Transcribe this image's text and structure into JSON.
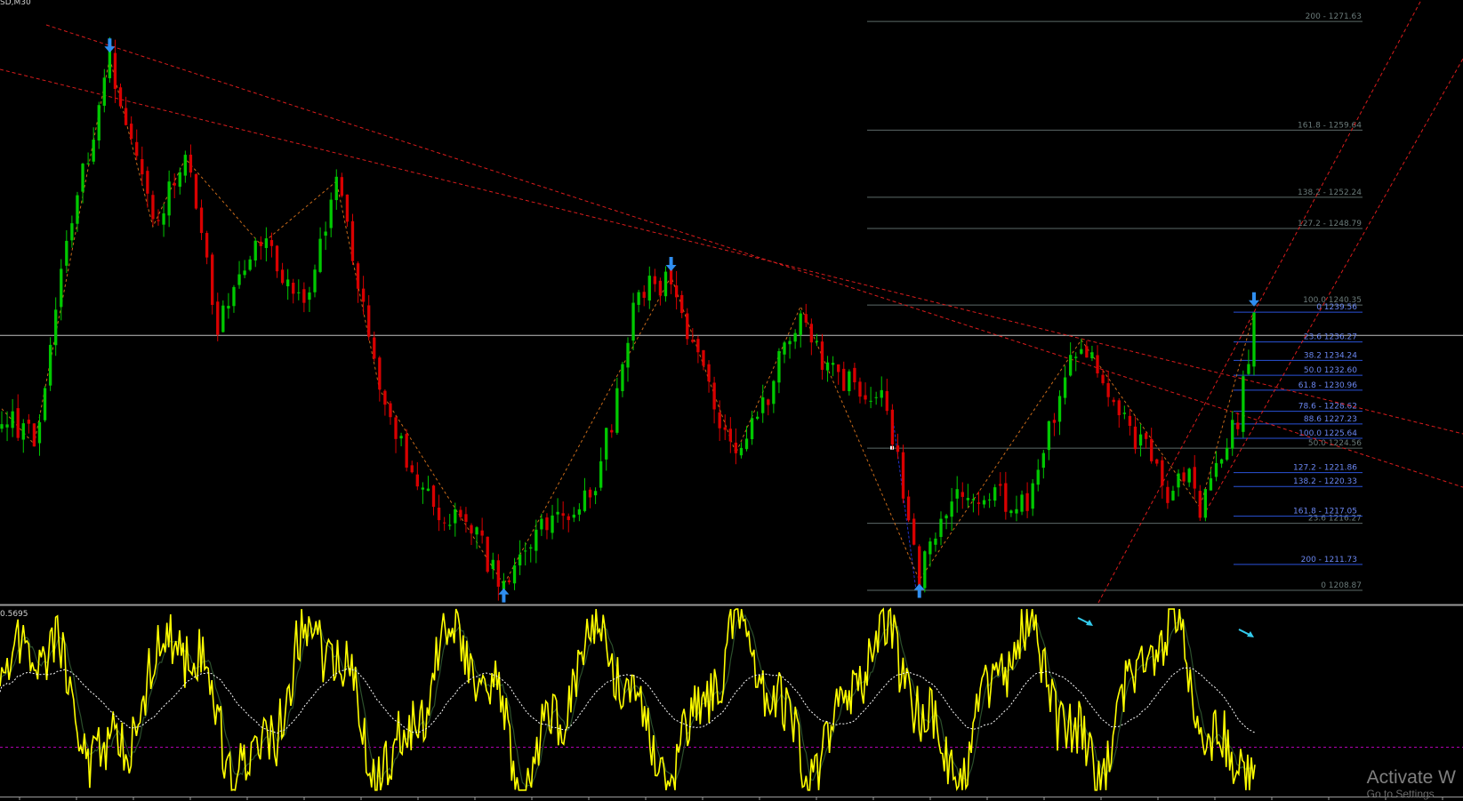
{
  "window": {
    "symbol_label": "SD,M30",
    "indicator_value": "0.5695"
  },
  "watermark": {
    "title": "Activate W",
    "subtitle": "Go to Settings"
  },
  "colors": {
    "background": "#000000",
    "bull_candle": "#00c800",
    "bear_candle": "#d80000",
    "trendline": "#d81c1c",
    "fib_grey": "#5d6a68",
    "fib_blue": "#2a52d8",
    "fib_text_grey": "#6b7b7a",
    "fib_text_blue": "#6a86f0",
    "arrow_blue": "#2f8ef0",
    "oscillator_main": "#ffff00",
    "oscillator_signal": "#ffffff",
    "oscillator_slow": "#2b4f2b",
    "level_line": "#b000b0",
    "divergence_arrow": "#33ccee"
  },
  "fib_grey_levels": [
    {
      "label": "200 - 1271.63",
      "price": 1271.63
    },
    {
      "label": "161.8 - 1259.64",
      "price": 1259.64
    },
    {
      "label": "138.2 - 1252.24",
      "price": 1252.24
    },
    {
      "label": "127.2 - 1248.79",
      "price": 1248.79
    },
    {
      "label": "100.0 1240.35",
      "price": 1240.35
    },
    {
      "label": "50.0 1224.56",
      "price": 1224.56
    },
    {
      "label": "23.6 1216.27",
      "price": 1216.27
    },
    {
      "label": "0 1208.87",
      "price": 1208.87
    }
  ],
  "fib_blue_levels": [
    {
      "label": "0 1239.56",
      "price": 1239.56
    },
    {
      "label": "23.6 1236.27",
      "price": 1236.27
    },
    {
      "label": "38.2 1234.24",
      "price": 1234.24
    },
    {
      "label": "50.0 1232.60",
      "price": 1232.6
    },
    {
      "label": "61.8 - 1230.96",
      "price": 1230.96
    },
    {
      "label": "78.6 - 1228.62",
      "price": 1228.62
    },
    {
      "label": "88.6 1227.23",
      "price": 1227.23
    },
    {
      "label": "100.0 1225.64",
      "price": 1225.64
    },
    {
      "label": "127.2 - 1221.86",
      "price": 1221.86
    },
    {
      "label": "138.2 - 1220.33",
      "price": 1220.33
    },
    {
      "label": "161.8 - 1217.05",
      "price": 1217.05
    },
    {
      "label": "200 - 1211.73",
      "price": 1211.73
    }
  ],
  "price_scale": {
    "y_min": 1207.5,
    "y_max": 1274.0
  },
  "current_price": 1237.0,
  "swing_points": [
    {
      "bar": 0,
      "price": 1228.9
    },
    {
      "bar": 6,
      "price": 1225.0
    },
    {
      "bar": 12,
      "price": 1247.5
    },
    {
      "bar": 20,
      "price": 1267.6
    },
    {
      "bar": 28,
      "price": 1249.0
    },
    {
      "bar": 34,
      "price": 1256.5
    },
    {
      "bar": 40,
      "price": 1238.0
    },
    {
      "bar": 48,
      "price": 1247.0
    },
    {
      "bar": 56,
      "price": 1241.0
    },
    {
      "bar": 62,
      "price": 1254.0
    },
    {
      "bar": 70,
      "price": 1231.0
    },
    {
      "bar": 78,
      "price": 1219.0
    },
    {
      "bar": 86,
      "price": 1216.0
    },
    {
      "bar": 93,
      "price": 1209.5
    },
    {
      "bar": 101,
      "price": 1216.5
    },
    {
      "bar": 110,
      "price": 1219.5
    },
    {
      "bar": 118,
      "price": 1242.0
    },
    {
      "bar": 124,
      "price": 1243.5
    },
    {
      "bar": 130,
      "price": 1232.0
    },
    {
      "bar": 136,
      "price": 1224.0
    },
    {
      "bar": 142,
      "price": 1231.0
    },
    {
      "bar": 148,
      "price": 1240.2
    },
    {
      "bar": 153,
      "price": 1233.0
    },
    {
      "bar": 158,
      "price": 1231.5
    },
    {
      "bar": 164,
      "price": 1229.5
    },
    {
      "bar": 170,
      "price": 1210.0
    },
    {
      "bar": 177,
      "price": 1221.0
    },
    {
      "bar": 184,
      "price": 1219.0
    },
    {
      "bar": 190,
      "price": 1218.5
    },
    {
      "bar": 195,
      "price": 1228.5
    },
    {
      "bar": 200,
      "price": 1236.5
    },
    {
      "bar": 206,
      "price": 1228.5
    },
    {
      "bar": 212,
      "price": 1224.0
    },
    {
      "bar": 216,
      "price": 1219.5
    },
    {
      "bar": 219,
      "price": 1222.0
    },
    {
      "bar": 222,
      "price": 1218.0
    },
    {
      "bar": 226,
      "price": 1225.0
    },
    {
      "bar": 229,
      "price": 1227.5
    },
    {
      "bar": 232,
      "price": 1239.5
    }
  ],
  "bar_count": 233
}
